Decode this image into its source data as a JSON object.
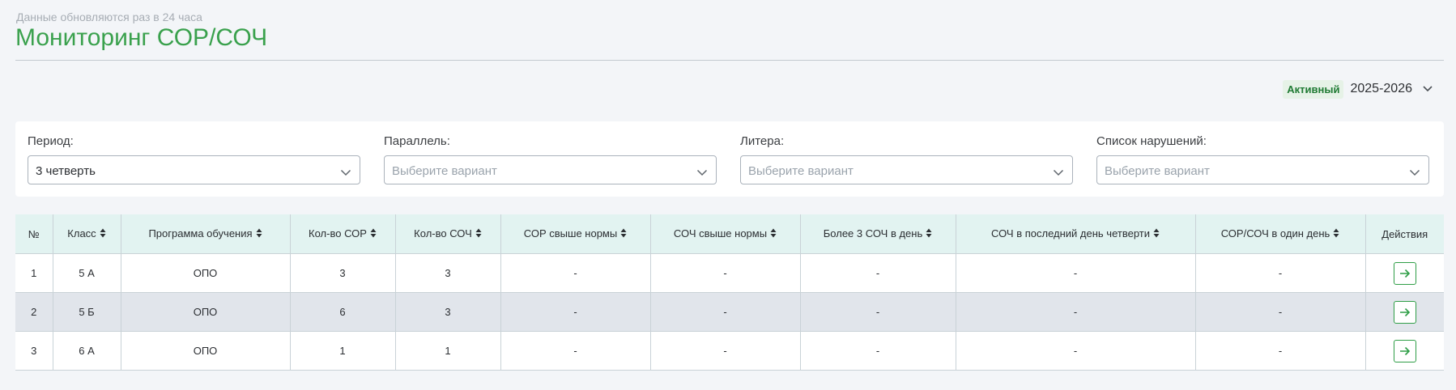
{
  "header": {
    "subtitle": "Данные обновляются раз в 24 часа",
    "title": "Мониторинг СОР/СОЧ"
  },
  "year": {
    "badge": "Активный",
    "value": "2025-2026"
  },
  "filters": [
    {
      "label": "Период:",
      "value": "3 четверть"
    },
    {
      "label": "Параллель:",
      "placeholder": "Выберите вариант"
    },
    {
      "label": "Литера:",
      "placeholder": "Выберите вариант"
    },
    {
      "label": "Список нарушений:",
      "placeholder": "Выберите вариант"
    }
  ],
  "table": {
    "columns": [
      "№",
      "Класс",
      "Программа обучения",
      "Кол-во СОР",
      "Кол-во СОЧ",
      "СОР свыше нормы",
      "СОЧ свыше нормы",
      "Более 3 СОЧ в день",
      "СОЧ в последний день четверти",
      "СОР/СОЧ в один день",
      "Действия"
    ],
    "rows": [
      [
        "1",
        "5 А",
        "ОПО",
        "3",
        "3",
        "-",
        "-",
        "-",
        "-",
        "-"
      ],
      [
        "2",
        "5 Б",
        "ОПО",
        "6",
        "3",
        "-",
        "-",
        "-",
        "-",
        "-"
      ],
      [
        "3",
        "6 А",
        "ОПО",
        "1",
        "1",
        "-",
        "-",
        "-",
        "-",
        "-"
      ]
    ]
  },
  "icons": {
    "select_chevron": "chevron-down-icon",
    "sort": "sort-icon",
    "action": "arrow-right-icon"
  },
  "colors": {
    "accent": "#3aa14d",
    "header_bg": "#e2f3f1",
    "alt_row": "#e1e5eb",
    "badge_bg": "#e6f2e7",
    "badge_text": "#1f7a33"
  }
}
